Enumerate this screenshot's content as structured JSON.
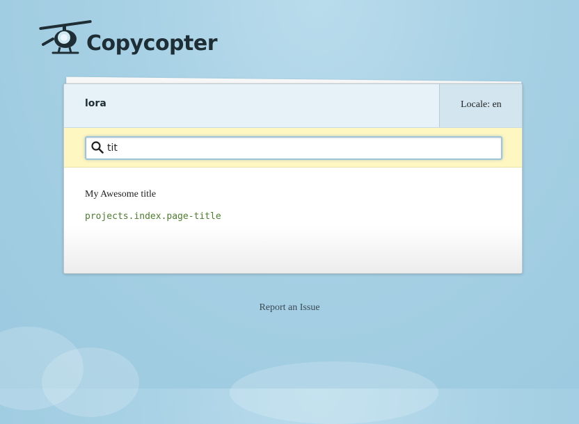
{
  "app": {
    "name": "Copycopter"
  },
  "project": {
    "name": "lora",
    "locale_label": "Locale: en"
  },
  "search": {
    "value": "tit"
  },
  "results": [
    {
      "content": "My Awesome title",
      "key": "projects.index.page-title"
    }
  ],
  "footer": {
    "report_label": "Report an Issue"
  },
  "icons": {
    "logo": "helicopter-icon",
    "search": "magnifier-icon"
  },
  "colors": {
    "background": "#a6d0e4",
    "header": "#e6f2f8",
    "search_bar": "#fff7c2",
    "key_text": "#4c7d2d",
    "logo_text": "#1f2e35"
  }
}
